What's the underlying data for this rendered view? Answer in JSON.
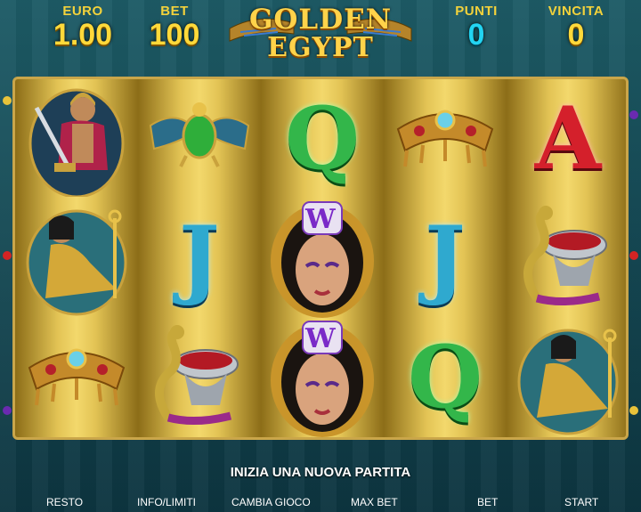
{
  "header": {
    "euro_label": "EURO",
    "euro_value": "1.00",
    "bet_label": "BET",
    "bet_value": "100",
    "points_label": "PUNTI",
    "points_value": "0",
    "win_label": "VINCITA",
    "win_value": "0"
  },
  "logo": {
    "line1": "GOLDEN",
    "line2": "EGYPT"
  },
  "reels": [
    [
      "warrior",
      "cleopatra-seated",
      "gold-collar"
    ],
    [
      "scarab",
      "letter-J",
      "cobra-bowl"
    ],
    [
      "letter-Q",
      "wild-queen",
      "wild-queen"
    ],
    [
      "gold-collar",
      "letter-J",
      "letter-Q"
    ],
    [
      "letter-A",
      "cobra-bowl",
      "cleopatra-seated"
    ]
  ],
  "symbols": {
    "Q": "Q",
    "J": "J",
    "A": "A",
    "wild": "W"
  },
  "message": "INIZIA UNA NUOVA PARTITA",
  "buttons": {
    "resto": "RESTO",
    "info": "INFO/LIMITI",
    "change_game": "CAMBIA GIOCO",
    "max_bet": "MAX BET",
    "bet": "BET",
    "start": "START"
  },
  "colors": {
    "gold": "#ffd93a",
    "cyan": "#22d4f2",
    "panel": "#0f3a44"
  }
}
